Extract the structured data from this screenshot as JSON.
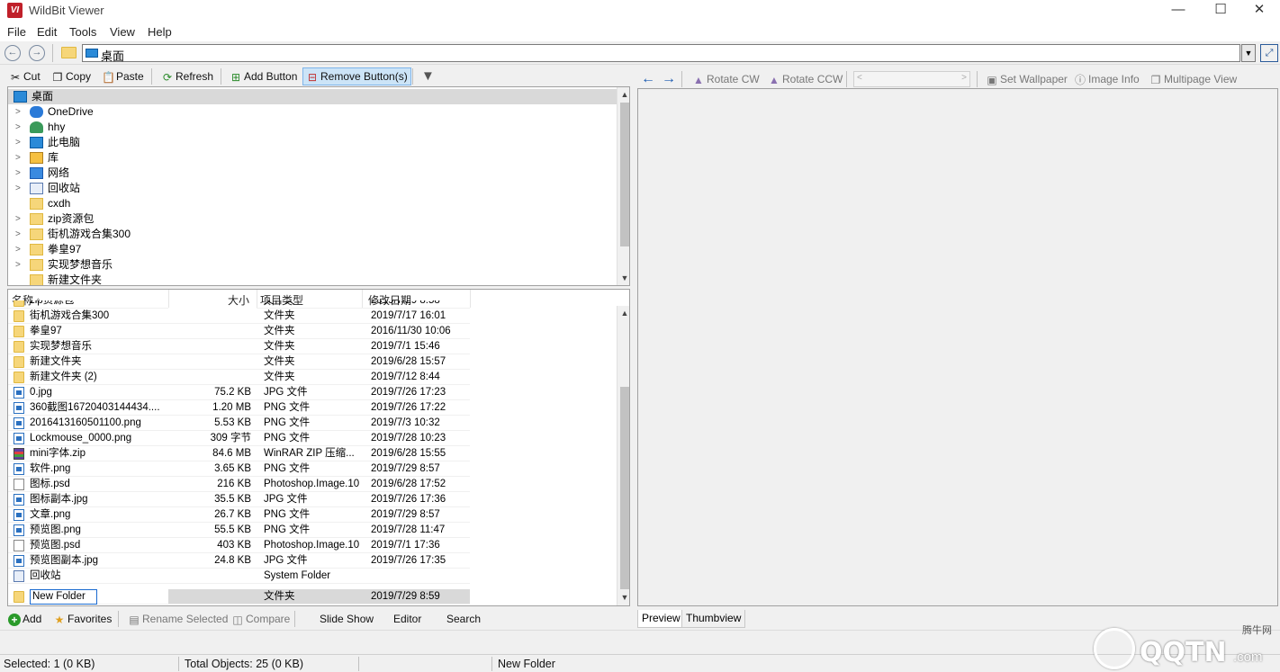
{
  "window": {
    "title": "WildBit Viewer",
    "app_icon": "VI"
  },
  "menu": [
    "File",
    "Edit",
    "Tools",
    "View",
    "Help"
  ],
  "address": {
    "value": "桌面"
  },
  "left_toolbar": {
    "cut": "Cut",
    "copy": "Copy",
    "paste": "Paste",
    "refresh": "Refresh",
    "add_button": "Add Button",
    "remove_buttons": "Remove Button(s)"
  },
  "tree": {
    "root": "桌面",
    "items": [
      {
        "label": "OneDrive",
        "icon": "cloud-icon",
        "expandable": true
      },
      {
        "label": "hhy",
        "icon": "user-icon",
        "expandable": true
      },
      {
        "label": "此电脑",
        "icon": "computer-icon",
        "expandable": true
      },
      {
        "label": "库",
        "icon": "library-icon",
        "expandable": true
      },
      {
        "label": "网络",
        "icon": "network-icon",
        "expandable": true
      },
      {
        "label": "回收站",
        "icon": "recycle-bin-icon",
        "expandable": true
      },
      {
        "label": "cxdh",
        "icon": "folder-icon",
        "expandable": false
      },
      {
        "label": "zip资源包",
        "icon": "folder-icon",
        "expandable": true
      },
      {
        "label": "街机游戏合集300",
        "icon": "folder-icon",
        "expandable": true
      },
      {
        "label": "拳皇97",
        "icon": "folder-icon",
        "expandable": true
      },
      {
        "label": "实现梦想音乐",
        "icon": "folder-icon",
        "expandable": true
      },
      {
        "label": "新建文件夹",
        "icon": "folder-icon",
        "expandable": false
      }
    ]
  },
  "file_list": {
    "headers": {
      "name": "名称",
      "size": "大小",
      "type": "项目类型",
      "modified": "修改日期"
    },
    "partial_row": {
      "name": "zip资源包",
      "type": "文件夹",
      "modified": "2019/7/29 8:58"
    },
    "rows": [
      {
        "name": "街机游戏合集300",
        "size": "",
        "type": "文件夹",
        "modified": "2019/7/17 16:01",
        "icon": "folder"
      },
      {
        "name": "拳皇97",
        "size": "",
        "type": "文件夹",
        "modified": "2016/11/30 10:06",
        "icon": "folder"
      },
      {
        "name": "实现梦想音乐",
        "size": "",
        "type": "文件夹",
        "modified": "2019/7/1 15:46",
        "icon": "folder"
      },
      {
        "name": "新建文件夹",
        "size": "",
        "type": "文件夹",
        "modified": "2019/6/28 15:57",
        "icon": "folder"
      },
      {
        "name": "新建文件夹 (2)",
        "size": "",
        "type": "文件夹",
        "modified": "2019/7/12 8:44",
        "icon": "folder"
      },
      {
        "name": "0.jpg",
        "size": "75.2 KB",
        "type": "JPG 文件",
        "modified": "2019/7/26 17:23",
        "icon": "image"
      },
      {
        "name": "360截图16720403144434....",
        "size": "1.20 MB",
        "type": "PNG 文件",
        "modified": "2019/7/26 17:22",
        "icon": "image"
      },
      {
        "name": "2016413160501100.png",
        "size": "5.53 KB",
        "type": "PNG 文件",
        "modified": "2019/7/3 10:32",
        "icon": "image"
      },
      {
        "name": "Lockmouse_0000.png",
        "size": "309 字节",
        "type": "PNG 文件",
        "modified": "2019/7/28 10:23",
        "icon": "image"
      },
      {
        "name": "mini字体.zip",
        "size": "84.6 MB",
        "type": "WinRAR ZIP 压缩...",
        "modified": "2019/6/28 15:55",
        "icon": "zip"
      },
      {
        "name": "软件.png",
        "size": "3.65 KB",
        "type": "PNG 文件",
        "modified": "2019/7/29 8:57",
        "icon": "image"
      },
      {
        "name": "图标.psd",
        "size": "216 KB",
        "type": "Photoshop.Image.10",
        "modified": "2019/6/28 17:52",
        "icon": "doc"
      },
      {
        "name": "图标副本.jpg",
        "size": "35.5 KB",
        "type": "JPG 文件",
        "modified": "2019/7/26 17:36",
        "icon": "image"
      },
      {
        "name": "文章.png",
        "size": "26.7 KB",
        "type": "PNG 文件",
        "modified": "2019/7/29 8:57",
        "icon": "image"
      },
      {
        "name": "预览图.png",
        "size": "55.5 KB",
        "type": "PNG 文件",
        "modified": "2019/7/28 11:47",
        "icon": "image"
      },
      {
        "name": "预览图.psd",
        "size": "403 KB",
        "type": "Photoshop.Image.10",
        "modified": "2019/7/1 17:36",
        "icon": "doc"
      },
      {
        "name": "预览图副本.jpg",
        "size": "24.8 KB",
        "type": "JPG 文件",
        "modified": "2019/7/26 17:35",
        "icon": "image"
      },
      {
        "name": "回收站",
        "size": "",
        "type": "System Folder",
        "modified": "",
        "icon": "system"
      }
    ],
    "editing_row": {
      "name": "New Folder",
      "type": "文件夹",
      "modified": "2019/7/29 8:59"
    }
  },
  "bottom_toolbar": {
    "add": "Add",
    "favorites": "Favorites",
    "rename_selected": "Rename Selected",
    "compare": "Compare",
    "slide_show": "Slide Show",
    "editor": "Editor",
    "search": "Search"
  },
  "right_toolbar": {
    "rotate_cw": "Rotate CW",
    "rotate_ccw": "Rotate CCW",
    "set_wallpaper": "Set Wallpaper",
    "image_info": "Image Info",
    "multipage_view": "Multipage View"
  },
  "tabs": [
    "Preview",
    "Thumbview"
  ],
  "status": {
    "selected": "Selected: 1 (0 KB)",
    "total": "Total Objects: 25 (0 KB)",
    "current": "New Folder"
  },
  "watermark": {
    "site": "QQTN",
    "domain": ".com",
    "cn": "腾牛网"
  },
  "colors": {
    "accent": "#1a6ad0",
    "selection": "#d9d9d9",
    "active_button": "#cce4f7",
    "app_red": "#c0202a"
  }
}
